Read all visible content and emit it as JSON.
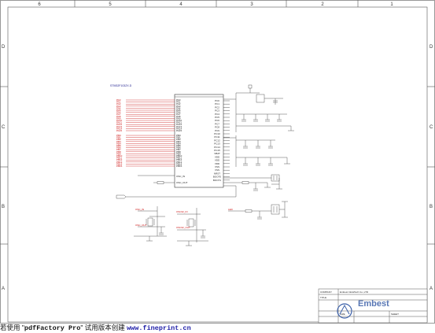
{
  "sheet": {
    "columns_top": [
      "6",
      "5",
      "4",
      "3",
      "2",
      "1"
    ],
    "rows_left": [
      "D",
      "C",
      "B",
      "A"
    ],
    "rows_right": [
      "D",
      "C",
      "B",
      "A"
    ]
  },
  "chip": {
    "title": "STM32F103ZX.D",
    "left_pins_top": [
      "PA0",
      "PA1",
      "PA2",
      "PA3",
      "PA4",
      "PA5",
      "PA6",
      "PA7",
      "PA8",
      "PA9",
      "PA10",
      "PA11",
      "PA12",
      "PA13",
      "PA14",
      "PA15"
    ],
    "left_pins_bottom": [
      "PB0",
      "PB1",
      "PB2",
      "PB3",
      "PB4",
      "PB5",
      "PB6",
      "PB7",
      "PB8",
      "PB9",
      "PB10",
      "PB11",
      "PB12",
      "PB13",
      "PB14",
      "PB15"
    ],
    "left_bottom_labels": [
      "OSC_IN",
      "OSC_OUT"
    ],
    "right_pins": [
      "PC0",
      "PC1",
      "PC2",
      "PC3",
      "PC4",
      "PC5",
      "PC6",
      "PC7",
      "PC8",
      "PC9",
      "PC10",
      "PC11",
      "PC12",
      "PC13",
      "PC14",
      "PC15",
      "VBAT",
      "VDD",
      "VDD",
      "VDD",
      "VSS",
      "VSS",
      "NRST",
      "BOOT0",
      "BOOT1"
    ]
  },
  "title_block": {
    "company_label": "COMPANY",
    "company_value": "Embest Info&Tech Co.,LTD",
    "title_label": "TITLE",
    "size_label": "SIZE",
    "sheet_label": "SHEET",
    "logo_text": "Embest"
  },
  "footer": {
    "prefix": "若使用 \"",
    "brand": "pdfFactory Pro",
    "middle": "\" 试用版本创建 ",
    "link": "www.fineprint.cn"
  }
}
